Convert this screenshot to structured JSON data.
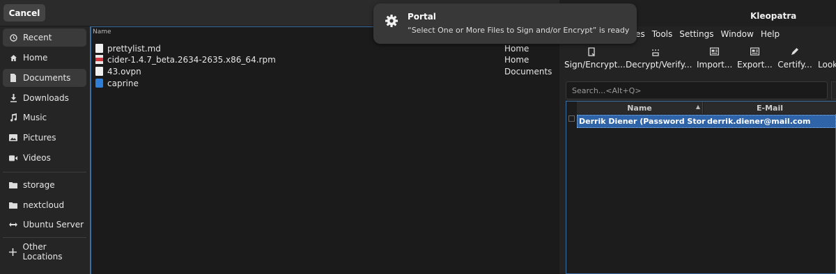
{
  "file_chooser": {
    "cancel_label": "Cancel",
    "column_name": "Name",
    "sidebar": [
      {
        "label": "Recent",
        "icon": "clock-icon"
      },
      {
        "label": "Home",
        "icon": "home-icon"
      },
      {
        "label": "Documents",
        "icon": "document-icon"
      },
      {
        "label": "Downloads",
        "icon": "download-icon"
      },
      {
        "label": "Music",
        "icon": "music-icon"
      },
      {
        "label": "Pictures",
        "icon": "pictures-icon"
      },
      {
        "label": "Videos",
        "icon": "video-icon"
      },
      {
        "label": "storage",
        "icon": "folder-icon"
      },
      {
        "label": "nextcloud",
        "icon": "folder-icon"
      },
      {
        "label": "Ubuntu Server",
        "icon": "network-icon"
      },
      {
        "label": "Other Locations",
        "icon": "plus-icon"
      }
    ],
    "files": [
      {
        "name": "prettylist.md",
        "location": "Home",
        "icon": "text-file-icon"
      },
      {
        "name": "cider-1.4.7_beta.2634-2635.x86_64.rpm",
        "location": "Home",
        "icon": "rpm-package-icon"
      },
      {
        "name": "43.ovpn",
        "location": "Documents",
        "icon": "text-file-icon"
      },
      {
        "name": "caprine",
        "location": "",
        "icon": "app-icon"
      }
    ]
  },
  "notification": {
    "title": "Portal",
    "body": "“Select One or More Files to Sign and/or Encrypt” is ready",
    "icon": "gear-icon"
  },
  "kleopatra": {
    "title": "Kleopatra",
    "menu": [
      "ates",
      "Tools",
      "Settings",
      "Window",
      "Help"
    ],
    "toolbar": [
      {
        "label": "Sign/Encrypt...",
        "icon": "sign-encrypt-icon"
      },
      {
        "label": "Decrypt/Verify...",
        "icon": "decrypt-verify-icon"
      },
      {
        "label": "Import...",
        "icon": "import-icon"
      },
      {
        "label": "Export...",
        "icon": "export-icon"
      },
      {
        "label": "Certify...",
        "icon": "certify-icon"
      },
      {
        "label": "Look",
        "icon": "lookup-icon"
      }
    ],
    "search_placeholder": "Search...<Alt+Q>",
    "columns": {
      "name": "Name",
      "email": "E-Mail"
    },
    "key_row": {
      "name": "Derrik Diener (Password Store ...",
      "email": "derrik.diener@mail.com"
    }
  },
  "colors": {
    "accent": "#3d6fa5",
    "selection": "#2f64a8",
    "notification_bg": "#383838"
  }
}
